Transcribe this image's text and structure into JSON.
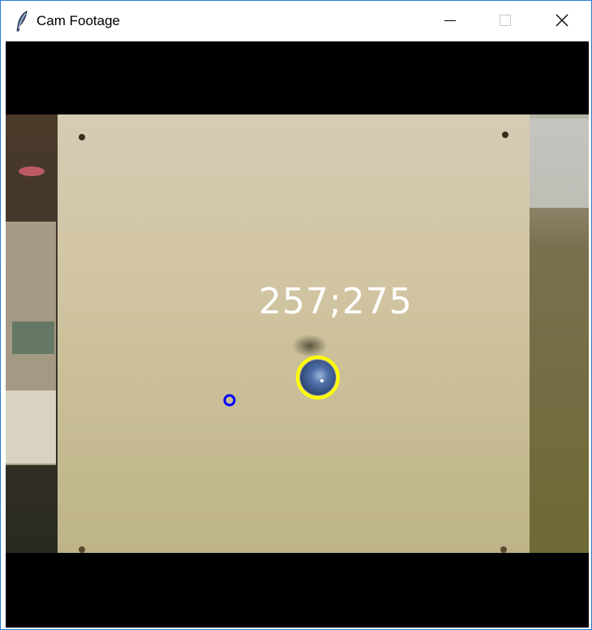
{
  "window": {
    "title": "Cam Footage",
    "app_icon": "tk-feather-icon",
    "controls": [
      "minimize-icon",
      "maximize-icon",
      "close-icon"
    ]
  },
  "overlay": {
    "coordinates": "257;275",
    "ball_marker_color": "#ffff00",
    "target_marker_color": "#0000ff",
    "text_color": "#ffffff"
  }
}
